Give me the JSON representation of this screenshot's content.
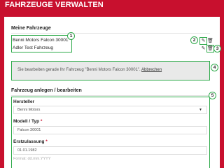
{
  "header": {
    "title": "FAHRZEUGE VERWALTEN"
  },
  "my_vehicles": {
    "title": "Meine Fahrzeuge",
    "items": [
      {
        "label": "Benni Motors Falcon 30001"
      },
      {
        "label": "Adler Test Fahrzeug"
      }
    ]
  },
  "callouts": {
    "c1": "1",
    "c2": "2",
    "c3": "3",
    "c4": "4",
    "c5": "5"
  },
  "notice": {
    "text": "Sie bearbeiten gerade Ihr Fahrzeug \"Benni Motors Falcon 30001\".",
    "cancel_link": "Abbrechen"
  },
  "form": {
    "title": "Fahrzeug anlegen / bearbeiten",
    "manufacturer_label": "Hersteller",
    "manufacturer_value": "Benni Motors",
    "model_label": "Modell / Typ",
    "model_value": "Falcon 30001",
    "registration_label": "Erstzulassung",
    "registration_value": "01.01.1982",
    "registration_hint": "Format: dd.mm.YYYY",
    "required_marker": "*"
  },
  "icons": {
    "edit": "edit-icon",
    "delete": "trash-icon",
    "select": "chevron-down-icon"
  },
  "colors": {
    "brand_red": "#c8102e",
    "callout_green": "#2eaa4a",
    "notice_bg": "#e9e9e9"
  }
}
